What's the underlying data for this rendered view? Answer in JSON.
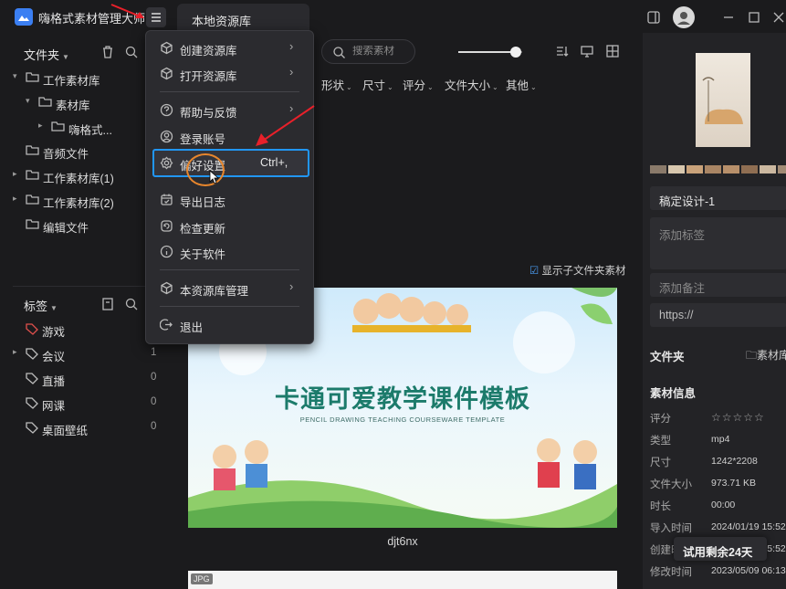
{
  "app": {
    "title": "嗨格式素材管理大师"
  },
  "tab": {
    "label": "本地资源库"
  },
  "sidebar": {
    "folders_header": "文件夹",
    "tree": [
      {
        "label": "工作素材库"
      },
      {
        "label": "素材库"
      },
      {
        "label": "嗨格式..."
      },
      {
        "label": "音频文件"
      },
      {
        "label": "工作素材库(1)"
      },
      {
        "label": "工作素材库(2)"
      },
      {
        "label": "编辑文件"
      }
    ],
    "tags_header": "标签",
    "tags": [
      {
        "label": "游戏",
        "count": ""
      },
      {
        "label": "会议",
        "count": "1"
      },
      {
        "label": "直播",
        "count": "0"
      },
      {
        "label": "网课",
        "count": "0"
      },
      {
        "label": "桌面壁纸",
        "count": "0"
      }
    ]
  },
  "toolbar": {
    "search_placeholder": "搜索素材",
    "thumbnail_size": 0.9,
    "filters": [
      "形状",
      "尺寸",
      "评分",
      "文件大小",
      "其他"
    ]
  },
  "menu": {
    "items": [
      {
        "icon": "cube-icon",
        "label": "创建资源库",
        "has_submenu": true
      },
      {
        "icon": "cube-icon",
        "label": "打开资源库",
        "has_submenu": true
      },
      {
        "icon": "help-icon",
        "label": "帮助与反馈",
        "has_submenu": true
      },
      {
        "icon": "user-icon",
        "label": "登录账号",
        "has_submenu": false
      },
      {
        "icon": "gear-icon",
        "label": "偏好设置",
        "shortcut": "Ctrl+,",
        "has_submenu": false
      },
      {
        "icon": "calendar-icon",
        "label": "导出日志",
        "has_submenu": false
      },
      {
        "icon": "refresh-icon",
        "label": "检查更新",
        "has_submenu": false
      },
      {
        "icon": "info-icon",
        "label": "关于软件",
        "has_submenu": false
      },
      {
        "icon": "cube-icon",
        "label": "本资源库管理",
        "has_submenu": true
      },
      {
        "icon": "logout-icon",
        "label": "退出",
        "has_submenu": false
      }
    ]
  },
  "content": {
    "show_subfolder_label": "显示子文件夹素材",
    "item": {
      "thumb_title": "卡通可爱教学课件模板",
      "thumb_subtitle": "PENCIL DRAWING TEACHING COURSEWARE TEMPLATE",
      "name": "djt6nx"
    },
    "next_item_badge": "JPG"
  },
  "details": {
    "palette": [
      "#8a7a6a",
      "#d8c7ae",
      "#c9a27a",
      "#a98564",
      "#b78f6a",
      "#8f6e52",
      "#cbb8a0",
      "#a18a74"
    ],
    "name": "稿定设计-1",
    "tags_placeholder": "添加标签",
    "note_placeholder": "添加备注",
    "url_placeholder": "https://",
    "folder_label": "文件夹",
    "folder_value": "素材库",
    "info_header": "素材信息",
    "info": [
      {
        "key": "评分",
        "value": "☆☆☆☆☆"
      },
      {
        "key": "类型",
        "value": "mp4"
      },
      {
        "key": "尺寸",
        "value": "1242*2208"
      },
      {
        "key": "文件大小",
        "value": "973.71 KB"
      },
      {
        "key": "时长",
        "value": "00:00"
      },
      {
        "key": "导入时间",
        "value": "2024/01/19 15:52"
      },
      {
        "key": "创建时间",
        "value": "2024/01/19 15:52"
      },
      {
        "key": "修改时间",
        "value": "2023/05/09 06:13"
      }
    ]
  },
  "trial": {
    "label": "试用剩余24天"
  }
}
